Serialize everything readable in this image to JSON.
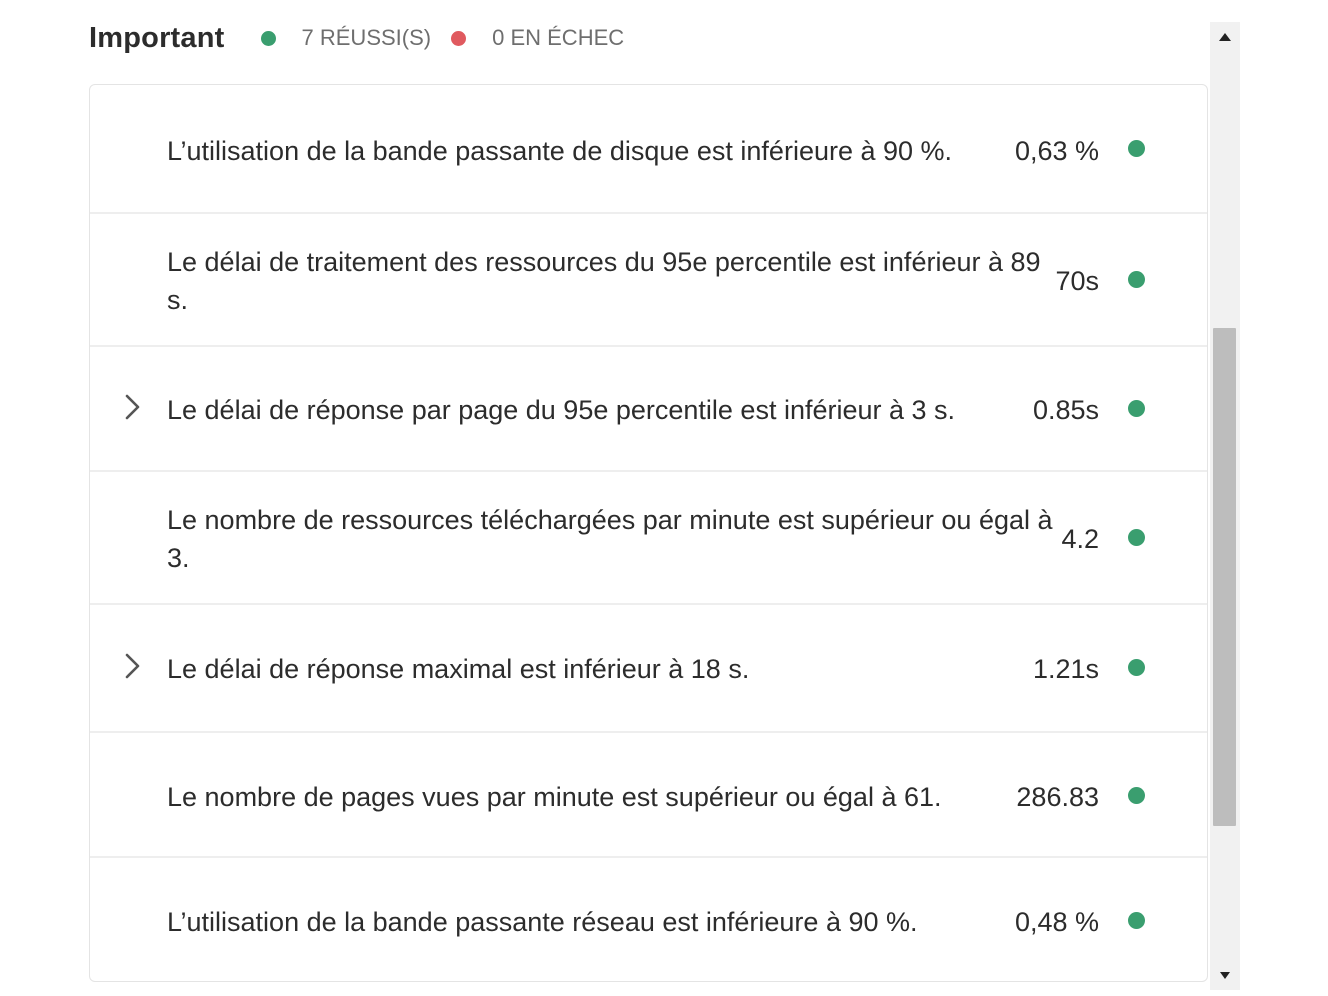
{
  "header": {
    "title": "Important",
    "passed_label": "7 RÉUSSI(S)",
    "failed_label": "0 EN ÉCHEC"
  },
  "colors": {
    "pass": "#3a9e6f",
    "fail": "#e05a5f",
    "text": "#2c2c2c",
    "muted": "#6e6e6e"
  },
  "rows": [
    {
      "label": "L’utilisation de la bande passante de disque est inférieure à 90 %.",
      "value": "0,63 %",
      "expandable": false,
      "status": "pass"
    },
    {
      "label": "Le délai de traitement des ressources du 95e percentile est inférieur à 89 s.",
      "value": "70s",
      "expandable": false,
      "status": "pass"
    },
    {
      "label": "Le délai de réponse par page du 95e percentile est inférieur à 3 s.",
      "value": "0.85s",
      "expandable": true,
      "status": "pass"
    },
    {
      "label": "Le nombre de ressources téléchargées par minute est supérieur ou égal à 3.",
      "value": "4.2",
      "expandable": false,
      "status": "pass"
    },
    {
      "label": "Le délai de réponse maximal est inférieur à 18 s.",
      "value": "1.21s",
      "expandable": true,
      "status": "pass"
    },
    {
      "label": "Le nombre de pages vues par minute est supérieur ou égal à 61.",
      "value": "286.83",
      "expandable": false,
      "status": "pass"
    },
    {
      "label": "L’utilisation de la bande passante réseau est inférieure à 90 %.",
      "value": "0,48 %",
      "expandable": false,
      "status": "pass"
    }
  ]
}
